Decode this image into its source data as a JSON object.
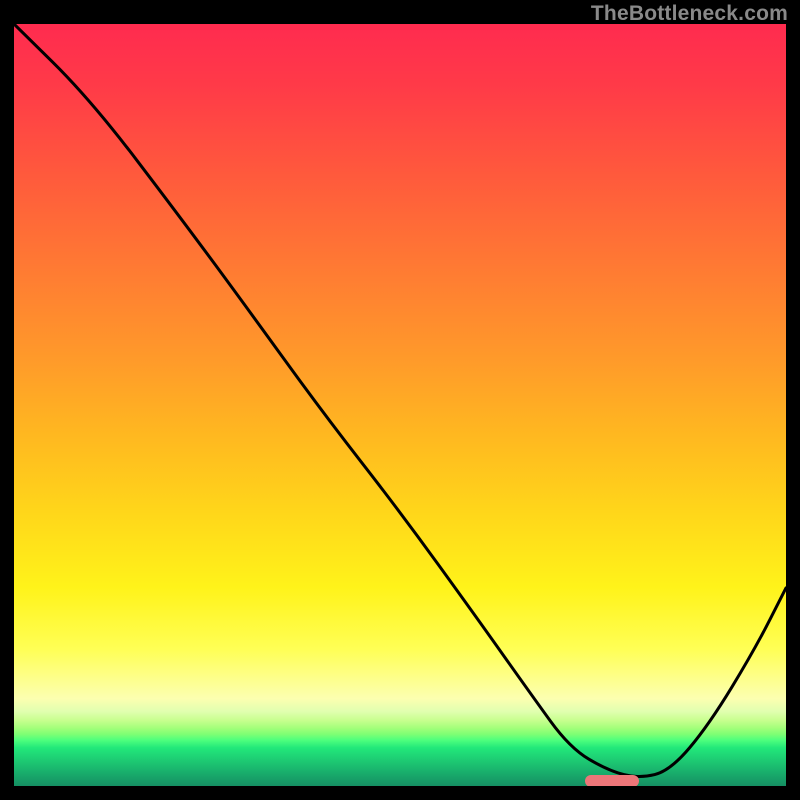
{
  "watermark": "TheBottleneck.com",
  "chart_data": {
    "type": "line",
    "title": "",
    "xlabel": "",
    "ylabel": "",
    "xlim": [
      0,
      100
    ],
    "ylim": [
      0,
      100
    ],
    "legend": false,
    "grid": false,
    "background": {
      "type": "vertical-gradient",
      "stops": [
        {
          "pos": 0,
          "color": "#ff2b4f"
        },
        {
          "pos": 50,
          "color": "#ffb820"
        },
        {
          "pos": 82,
          "color": "#ffff55"
        },
        {
          "pos": 94,
          "color": "#4dff7d"
        },
        {
          "pos": 100,
          "color": "#158f63"
        }
      ]
    },
    "series": [
      {
        "name": "bottleneck-curve",
        "color": "#000000",
        "x": [
          0,
          10,
          22,
          30,
          40,
          50,
          60,
          67,
          72,
          77,
          81,
          85,
          90,
          96,
          100
        ],
        "values": [
          100,
          90,
          74,
          63,
          49,
          36,
          22,
          12,
          5,
          2,
          1,
          2,
          8,
          18,
          26
        ]
      }
    ],
    "annotations": [
      {
        "name": "optimal-marker",
        "type": "pill",
        "color": "#ed7679",
        "x_start": 74,
        "x_end": 81,
        "y": 0.6
      }
    ]
  }
}
